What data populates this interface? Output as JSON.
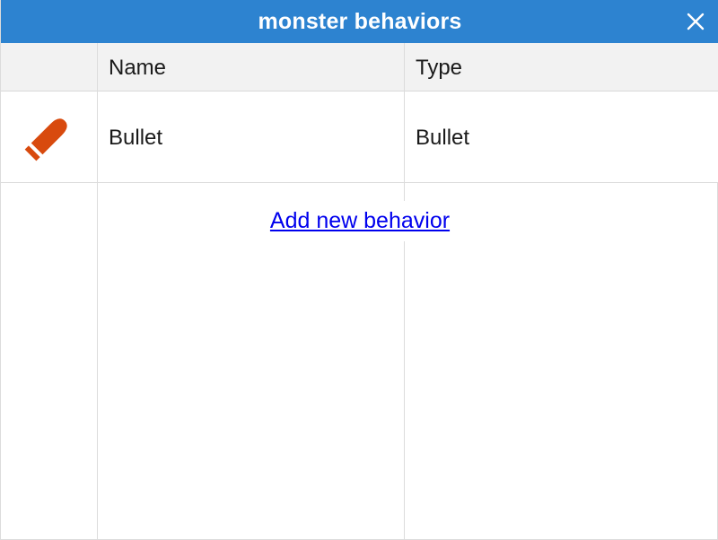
{
  "window": {
    "title": "monster behaviors",
    "close_icon": "close-x-icon"
  },
  "table": {
    "columns": [
      "",
      "Name",
      "Type"
    ],
    "rows": [
      {
        "icon": "bullet-icon",
        "icon_color": "#d84a0e",
        "name": "Bullet",
        "type": "Bullet"
      }
    ]
  },
  "actions": {
    "add_label": "Add new behavior"
  },
  "colors": {
    "titlebar": "#2d83d0",
    "link": "#0000ee"
  }
}
